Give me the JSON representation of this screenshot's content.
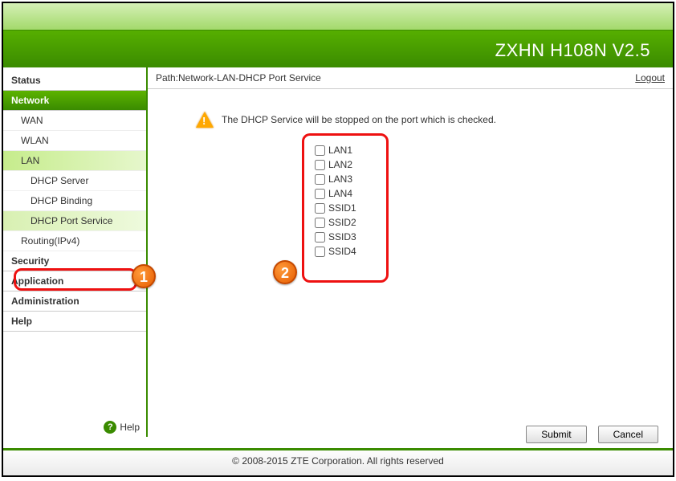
{
  "header": {
    "title": "ZXHN H108N V2.5"
  },
  "path": {
    "label": "Path:Network-LAN-DHCP Port Service",
    "logout": "Logout"
  },
  "sidebar": {
    "status": "Status",
    "network": "Network",
    "wan": "WAN",
    "wlan": "WLAN",
    "lan": "LAN",
    "dhcp_server": "DHCP Server",
    "dhcp_binding": "DHCP Binding",
    "dhcp_port_service": "DHCP Port Service",
    "routing": "Routing(IPv4)",
    "security": "Security",
    "application": "Application",
    "administration": "Administration",
    "help": "Help",
    "help_link": "Help"
  },
  "info": {
    "text": "The DHCP Service will be stopped on the port which is checked."
  },
  "ports": {
    "items": [
      {
        "label": "LAN1"
      },
      {
        "label": "LAN2"
      },
      {
        "label": "LAN3"
      },
      {
        "label": "LAN4"
      },
      {
        "label": "SSID1"
      },
      {
        "label": "SSID2"
      },
      {
        "label": "SSID3"
      },
      {
        "label": "SSID4"
      }
    ]
  },
  "buttons": {
    "submit": "Submit",
    "cancel": "Cancel"
  },
  "footer": {
    "copyright": "© 2008-2015 ZTE Corporation. All rights reserved"
  },
  "annotations": {
    "one": "1",
    "two": "2"
  }
}
